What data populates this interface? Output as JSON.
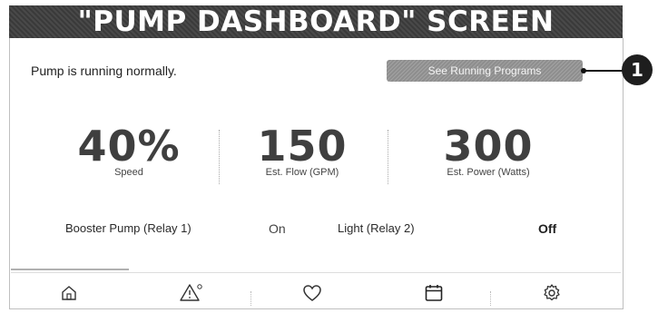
{
  "banner": {
    "title": "\"PUMP DASHBOARD\" SCREEN"
  },
  "status": {
    "text": "Pump is running normally."
  },
  "programs_button": {
    "label": "See Running Programs"
  },
  "callout": {
    "number": "1"
  },
  "metrics": [
    {
      "value": "40%",
      "label": "Speed"
    },
    {
      "value": "150",
      "label": "Est. Flow (GPM)"
    },
    {
      "value": "300",
      "label": "Est. Power (Watts)"
    }
  ],
  "relays": [
    {
      "label": "Booster Pump (Relay 1)",
      "state": "On"
    },
    {
      "label": "Light (Relay 2)",
      "state": "Off"
    }
  ],
  "nav": {
    "items": [
      {
        "icon": "home-icon"
      },
      {
        "icon": "alert-icon"
      },
      {
        "icon": "heart-icon"
      },
      {
        "icon": "calendar-icon"
      },
      {
        "icon": "settings-icon"
      }
    ]
  }
}
